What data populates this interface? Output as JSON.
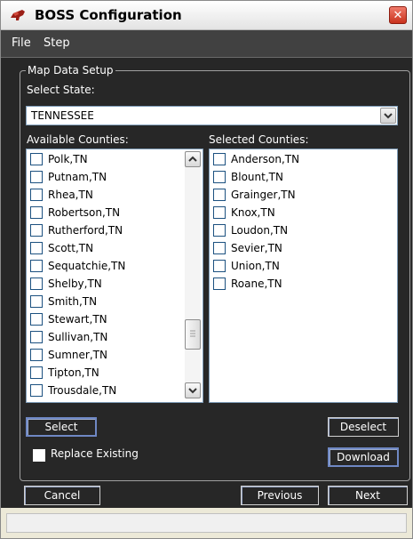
{
  "window": {
    "title": "BOSS Configuration",
    "close_label": "✕"
  },
  "menu": {
    "items": [
      "File",
      "Step"
    ]
  },
  "group": {
    "legend": "Map Data Setup",
    "state_label": "Select State:",
    "state_value": "TENNESSEE",
    "available_label": "Available Counties:",
    "selected_label": "Selected Counties:",
    "available": [
      "Polk,TN",
      "Putnam,TN",
      "Rhea,TN",
      "Robertson,TN",
      "Rutherford,TN",
      "Scott,TN",
      "Sequatchie,TN",
      "Shelby,TN",
      "Smith,TN",
      "Stewart,TN",
      "Sullivan,TN",
      "Sumner,TN",
      "Tipton,TN",
      "Trousdale,TN"
    ],
    "selected": [
      "Anderson,TN",
      "Blount,TN",
      "Grainger,TN",
      "Knox,TN",
      "Loudon,TN",
      "Sevier,TN",
      "Union,TN",
      "Roane,TN"
    ],
    "available_scroll_position": 0.82
  },
  "actions": {
    "select_label": "Select",
    "deselect_label": "Deselect",
    "replace_label": "Replace Existing",
    "download_label": "Download"
  },
  "nav": {
    "cancel_label": "Cancel",
    "previous_label": "Previous",
    "next_label": "Next"
  },
  "colors": {
    "panel_bg": "#272727",
    "menubar_bg": "#414141",
    "focus_border": "#6f88c4"
  }
}
